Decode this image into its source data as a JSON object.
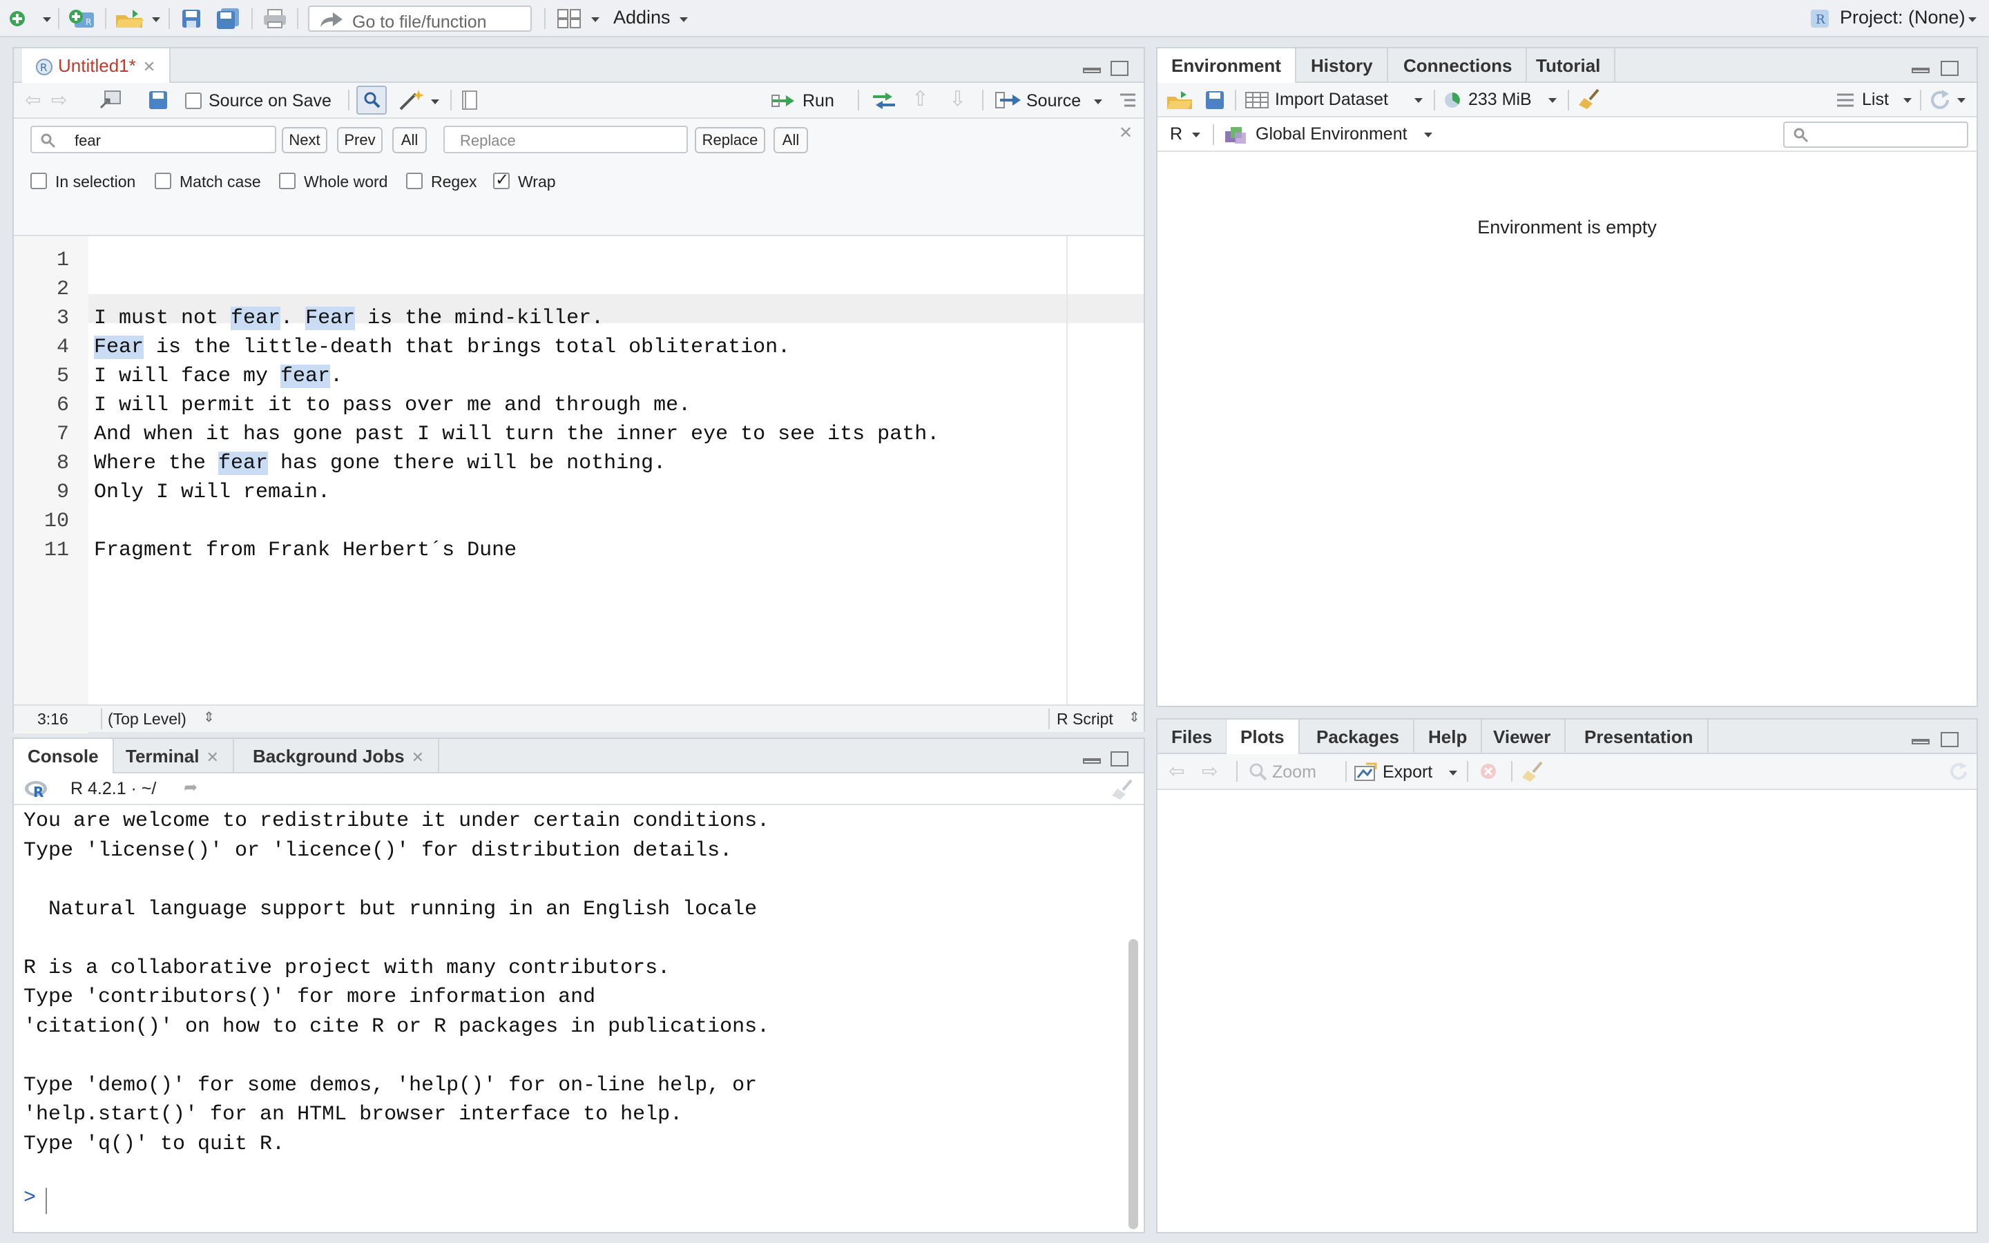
{
  "toolbar": {
    "goto_placeholder": "Go to file/function",
    "addins_label": "Addins",
    "project_label": "Project: (None)"
  },
  "editor": {
    "tab_label": "Untitled1*",
    "source_on_save_label": "Source on Save",
    "run_label": "Run",
    "source_label": "Source",
    "find": {
      "search_value": "fear",
      "next_label": "Next",
      "prev_label": "Prev",
      "all_label": "All",
      "replace_placeholder": "Replace",
      "replace_label": "Replace",
      "replace_all_label": "All",
      "options": [
        "In selection",
        "Match case",
        "Whole word",
        "Regex",
        "Wrap"
      ],
      "wrap_checked": true
    },
    "line_numbers": [
      "1",
      "2",
      "3",
      "4",
      "5",
      "6",
      "7",
      "8",
      "9",
      "10",
      "11"
    ],
    "lines": [
      "",
      "",
      "I must not fear. Fear is the mind-killer.",
      "Fear is the little-death that brings total obliteration.",
      "I will face my fear.",
      "I will permit it to pass over me and through me.",
      "And when it has gone past I will turn the inner eye to see its path.",
      "Where the fear has gone there will be nothing.",
      "Only I will remain.",
      "",
      "Fragment from Frank Herbert´s Dune"
    ],
    "status_position": "3:16",
    "status_scope": "(Top Level)",
    "status_filetype": "R Script"
  },
  "console": {
    "tabs": [
      "Console",
      "Terminal",
      "Background Jobs"
    ],
    "version_label": "R 4.2.1 · ~/",
    "lines": [
      "You are welcome to redistribute it under certain conditions.",
      "Type 'license()' or 'licence()' for distribution details.",
      "",
      "  Natural language support but running in an English locale",
      "",
      "R is a collaborative project with many contributors.",
      "Type 'contributors()' for more information and",
      "'citation()' on how to cite R or R packages in publications.",
      "",
      "Type 'demo()' for some demos, 'help()' for on-line help, or",
      "'help.start()' for an HTML browser interface to help.",
      "Type 'q()' to quit R."
    ],
    "prompt": ">"
  },
  "environment": {
    "tabs": [
      "Environment",
      "History",
      "Connections",
      "Tutorial"
    ],
    "import_label": "Import Dataset",
    "memory_label": "233 MiB",
    "list_label": "List",
    "lang_label": "R",
    "scope_label": "Global Environment",
    "empty_message": "Environment is empty"
  },
  "files": {
    "tabs": [
      "Files",
      "Plots",
      "Packages",
      "Help",
      "Viewer",
      "Presentation"
    ],
    "zoom_label": "Zoom",
    "export_label": "Export"
  },
  "colors": {
    "accent": "#3a6fb0",
    "highlight": "#c9dcf3",
    "tab_active_text": "#c0392b"
  }
}
